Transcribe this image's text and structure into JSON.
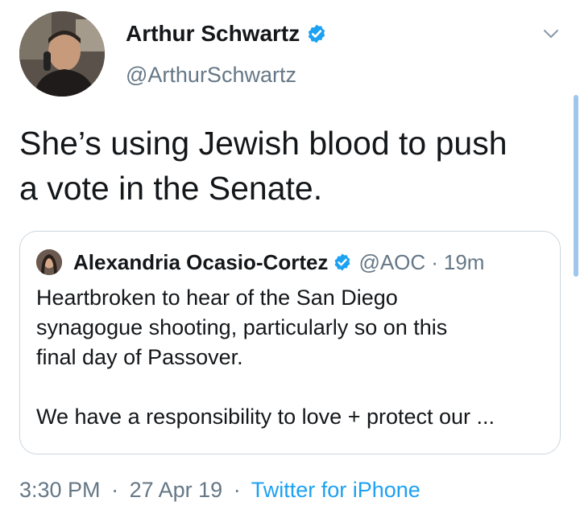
{
  "author": {
    "name": "Arthur Schwartz",
    "handle": "@ArthurSchwartz",
    "verified_icon": "verified-badge-icon",
    "avatar_icon": "profile-photo"
  },
  "tweet": {
    "text_lines": [
      "She’s using Jewish blood to push",
      "a vote in the Senate."
    ]
  },
  "quoted_tweet": {
    "name": "Alexandria Ocasio-Cortez",
    "handle": "@AOC",
    "separator": "·",
    "time": "19m",
    "body_lines": [
      "Heartbroken to hear of the San Diego",
      "synagogue shooting, particularly so on this",
      "final day of Passover.",
      "",
      "We have a responsibility to love + protect our ..."
    ]
  },
  "meta": {
    "time": "3:30 PM",
    "sep1": "·",
    "date": "27 Apr 19",
    "sep2": "·",
    "source": "Twitter for iPhone"
  },
  "colors": {
    "accent": "#1da1f2",
    "text": "#14171a",
    "secondary": "#657786",
    "border": "#ccd6dd"
  }
}
